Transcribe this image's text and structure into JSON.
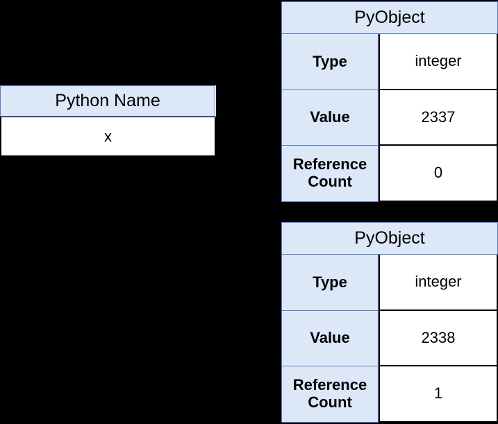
{
  "background_color": "#000000",
  "accent_color": "#dce7f8",
  "border_color": "#5b7fc4",
  "python_name_box": {
    "header": "Python Name",
    "value": "x"
  },
  "pyobjects": [
    {
      "header": "PyObject",
      "rows": [
        {
          "label": "Type",
          "value": "integer"
        },
        {
          "label": "Value",
          "value": "2337"
        },
        {
          "label": "Reference Count",
          "value": "0"
        }
      ]
    },
    {
      "header": "PyObject",
      "rows": [
        {
          "label": "Type",
          "value": "integer"
        },
        {
          "label": "Value",
          "value": "2338"
        },
        {
          "label": "Reference Count",
          "value": "1"
        }
      ]
    }
  ]
}
